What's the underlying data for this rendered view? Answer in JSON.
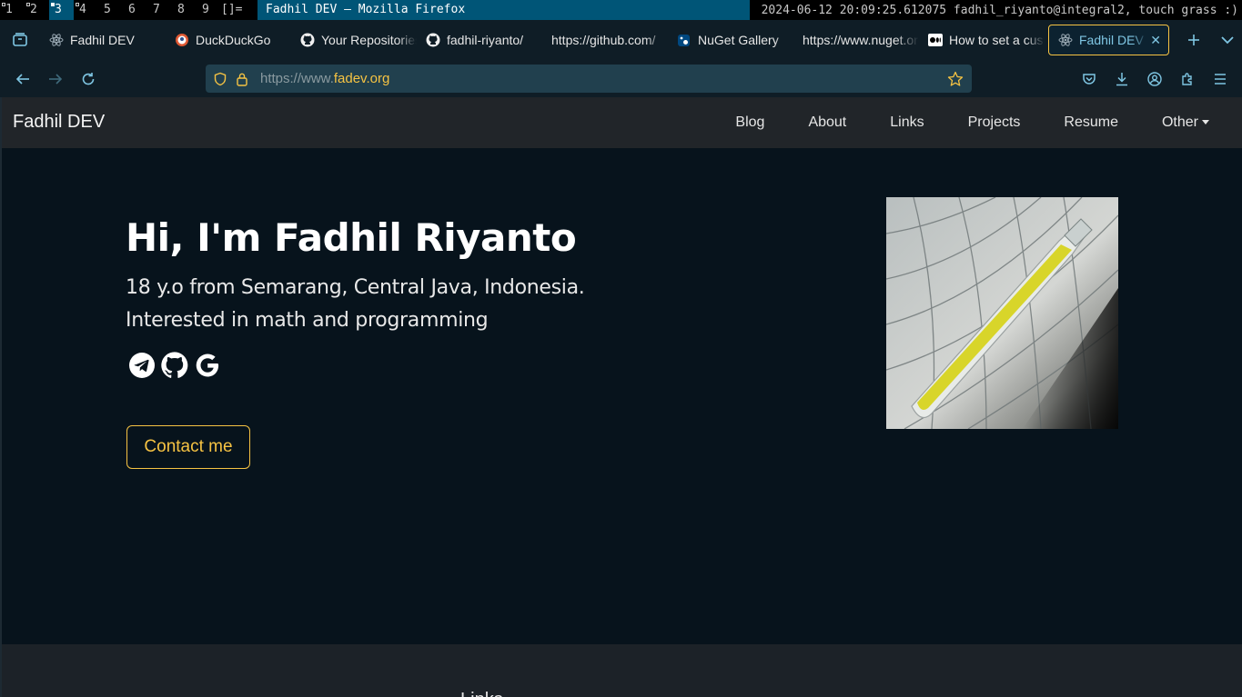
{
  "wm": {
    "workspaces": [
      "1",
      "2",
      "3",
      "4",
      "5",
      "6",
      "7",
      "8",
      "9"
    ],
    "layout": "[]=",
    "window_title": "Fadhil DEV — Mozilla Firefox",
    "status": "2024-06-12 20:09:25.612075 fadhil_riyanto@integral2, touch grass :)"
  },
  "tabs": [
    {
      "label": "Fadhil DEV",
      "icon": "react-icon"
    },
    {
      "label": "DuckDuckGo",
      "icon": "duckduckgo-icon"
    },
    {
      "label": "Your Repositories",
      "icon": "github-icon"
    },
    {
      "label": "fadhil-riyanto/",
      "icon": "github-icon"
    },
    {
      "label": "https://github.com/",
      "icon": ""
    },
    {
      "label": "NuGet Gallery",
      "icon": "nuget-icon"
    },
    {
      "label": "https://www.nuget.org",
      "icon": ""
    },
    {
      "label": "How to set a custom",
      "icon": "medium-icon"
    }
  ],
  "active_tab": {
    "label": "Fadhil DEV",
    "icon": "react-icon"
  },
  "urlbar": {
    "prefix": "https://www.",
    "host": "fadev.org"
  },
  "site": {
    "brand": "Fadhil DEV",
    "menu": [
      "Blog",
      "About",
      "Links",
      "Projects",
      "Resume"
    ],
    "menu_dropdown": "Other",
    "hero_title": "Hi, I'm Fadhil Riyanto",
    "hero_sub1": "18 y.o from Semarang, Central Java, Indonesia.",
    "hero_sub2": "Interested in math and programming",
    "social": [
      "telegram-icon",
      "github-icon",
      "google-icon"
    ],
    "contact_label": "Contact me",
    "footer_heading": "Links"
  },
  "colors": {
    "accent": "#f6c343",
    "page_bg": "#07131c",
    "navbar_bg": "#212529",
    "firefox_accent": "#7fc6e3"
  }
}
